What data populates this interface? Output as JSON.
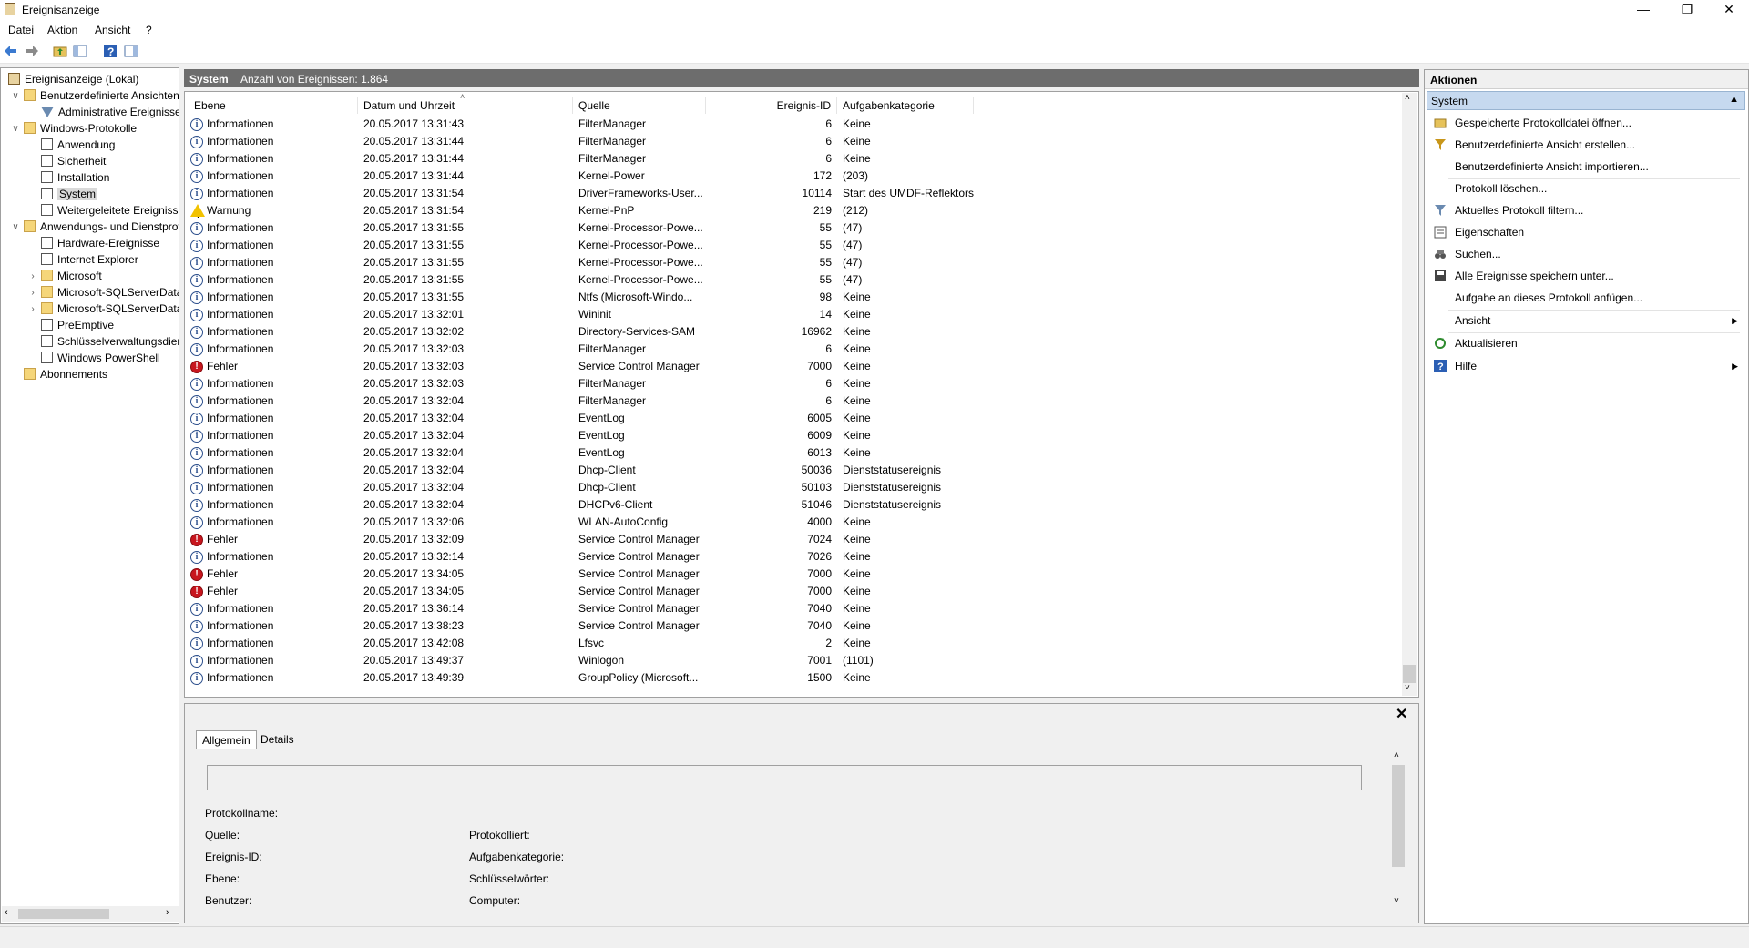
{
  "window": {
    "title": "Ereignisanzeige",
    "minimize": "—",
    "restore": "❐",
    "close": "✕"
  },
  "menu": [
    "Datei",
    "Aktion",
    "Ansicht",
    "?"
  ],
  "tree": {
    "root": "Ereignisanzeige (Lokal)",
    "custom_views": "Benutzerdefinierte Ansichten",
    "admin_events": "Administrative Ereignisse",
    "windows_logs": "Windows-Protokolle",
    "application": "Anwendung",
    "security": "Sicherheit",
    "setup": "Installation",
    "system": "System",
    "forwarded": "Weitergeleitete Ereignisse",
    "apps_services": "Anwendungs- und Dienstprotokolle",
    "hardware": "Hardware-Ereignisse",
    "ie": "Internet Explorer",
    "microsoft": "Microsoft",
    "sql1": "Microsoft-SQLServerDataTools",
    "sql2": "Microsoft-SQLServerDataToolsVS",
    "preemptive": "PreEmptive",
    "keymgmt": "Schlüsselverwaltungsdienst",
    "powershell": "Windows PowerShell",
    "subscriptions": "Abonnements"
  },
  "center": {
    "log_name": "System",
    "event_count": "Anzahl von Ereignissen: 1.864",
    "columns": {
      "level": "Ebene",
      "date": "Datum und Uhrzeit",
      "source": "Quelle",
      "id": "Ereignis-ID",
      "category": "Aufgabenkategorie"
    }
  },
  "events": [
    {
      "level": "info",
      "level_text": "Informationen",
      "date": "20.05.2017 13:31:43",
      "source": "FilterManager",
      "id": "6",
      "category": "Keine"
    },
    {
      "level": "info",
      "level_text": "Informationen",
      "date": "20.05.2017 13:31:44",
      "source": "FilterManager",
      "id": "6",
      "category": "Keine"
    },
    {
      "level": "info",
      "level_text": "Informationen",
      "date": "20.05.2017 13:31:44",
      "source": "FilterManager",
      "id": "6",
      "category": "Keine"
    },
    {
      "level": "info",
      "level_text": "Informationen",
      "date": "20.05.2017 13:31:44",
      "source": "Kernel-Power",
      "id": "172",
      "category": "(203)"
    },
    {
      "level": "info",
      "level_text": "Informationen",
      "date": "20.05.2017 13:31:54",
      "source": "DriverFrameworks-User...",
      "id": "10114",
      "category": "Start des UMDF-Reflektors"
    },
    {
      "level": "warn",
      "level_text": "Warnung",
      "date": "20.05.2017 13:31:54",
      "source": "Kernel-PnP",
      "id": "219",
      "category": "(212)"
    },
    {
      "level": "info",
      "level_text": "Informationen",
      "date": "20.05.2017 13:31:55",
      "source": "Kernel-Processor-Powe...",
      "id": "55",
      "category": "(47)"
    },
    {
      "level": "info",
      "level_text": "Informationen",
      "date": "20.05.2017 13:31:55",
      "source": "Kernel-Processor-Powe...",
      "id": "55",
      "category": "(47)"
    },
    {
      "level": "info",
      "level_text": "Informationen",
      "date": "20.05.2017 13:31:55",
      "source": "Kernel-Processor-Powe...",
      "id": "55",
      "category": "(47)"
    },
    {
      "level": "info",
      "level_text": "Informationen",
      "date": "20.05.2017 13:31:55",
      "source": "Kernel-Processor-Powe...",
      "id": "55",
      "category": "(47)"
    },
    {
      "level": "info",
      "level_text": "Informationen",
      "date": "20.05.2017 13:31:55",
      "source": "Ntfs (Microsoft-Windo...",
      "id": "98",
      "category": "Keine"
    },
    {
      "level": "info",
      "level_text": "Informationen",
      "date": "20.05.2017 13:32:01",
      "source": "Wininit",
      "id": "14",
      "category": "Keine"
    },
    {
      "level": "info",
      "level_text": "Informationen",
      "date": "20.05.2017 13:32:02",
      "source": "Directory-Services-SAM",
      "id": "16962",
      "category": "Keine"
    },
    {
      "level": "info",
      "level_text": "Informationen",
      "date": "20.05.2017 13:32:03",
      "source": "FilterManager",
      "id": "6",
      "category": "Keine"
    },
    {
      "level": "err",
      "level_text": "Fehler",
      "date": "20.05.2017 13:32:03",
      "source": "Service Control Manager",
      "id": "7000",
      "category": "Keine"
    },
    {
      "level": "info",
      "level_text": "Informationen",
      "date": "20.05.2017 13:32:03",
      "source": "FilterManager",
      "id": "6",
      "category": "Keine"
    },
    {
      "level": "info",
      "level_text": "Informationen",
      "date": "20.05.2017 13:32:04",
      "source": "FilterManager",
      "id": "6",
      "category": "Keine"
    },
    {
      "level": "info",
      "level_text": "Informationen",
      "date": "20.05.2017 13:32:04",
      "source": "EventLog",
      "id": "6005",
      "category": "Keine"
    },
    {
      "level": "info",
      "level_text": "Informationen",
      "date": "20.05.2017 13:32:04",
      "source": "EventLog",
      "id": "6009",
      "category": "Keine"
    },
    {
      "level": "info",
      "level_text": "Informationen",
      "date": "20.05.2017 13:32:04",
      "source": "EventLog",
      "id": "6013",
      "category": "Keine"
    },
    {
      "level": "info",
      "level_text": "Informationen",
      "date": "20.05.2017 13:32:04",
      "source": "Dhcp-Client",
      "id": "50036",
      "category": "Dienststatusereignis"
    },
    {
      "level": "info",
      "level_text": "Informationen",
      "date": "20.05.2017 13:32:04",
      "source": "Dhcp-Client",
      "id": "50103",
      "category": "Dienststatusereignis"
    },
    {
      "level": "info",
      "level_text": "Informationen",
      "date": "20.05.2017 13:32:04",
      "source": "DHCPv6-Client",
      "id": "51046",
      "category": "Dienststatusereignis"
    },
    {
      "level": "info",
      "level_text": "Informationen",
      "date": "20.05.2017 13:32:06",
      "source": "WLAN-AutoConfig",
      "id": "4000",
      "category": "Keine"
    },
    {
      "level": "err",
      "level_text": "Fehler",
      "date": "20.05.2017 13:32:09",
      "source": "Service Control Manager",
      "id": "7024",
      "category": "Keine"
    },
    {
      "level": "info",
      "level_text": "Informationen",
      "date": "20.05.2017 13:32:14",
      "source": "Service Control Manager",
      "id": "7026",
      "category": "Keine"
    },
    {
      "level": "err",
      "level_text": "Fehler",
      "date": "20.05.2017 13:34:05",
      "source": "Service Control Manager",
      "id": "7000",
      "category": "Keine"
    },
    {
      "level": "err",
      "level_text": "Fehler",
      "date": "20.05.2017 13:34:05",
      "source": "Service Control Manager",
      "id": "7000",
      "category": "Keine"
    },
    {
      "level": "info",
      "level_text": "Informationen",
      "date": "20.05.2017 13:36:14",
      "source": "Service Control Manager",
      "id": "7040",
      "category": "Keine"
    },
    {
      "level": "info",
      "level_text": "Informationen",
      "date": "20.05.2017 13:38:23",
      "source": "Service Control Manager",
      "id": "7040",
      "category": "Keine"
    },
    {
      "level": "info",
      "level_text": "Informationen",
      "date": "20.05.2017 13:42:08",
      "source": "Lfsvc",
      "id": "2",
      "category": "Keine"
    },
    {
      "level": "info",
      "level_text": "Informationen",
      "date": "20.05.2017 13:49:37",
      "source": "Winlogon",
      "id": "7001",
      "category": "(1101)"
    },
    {
      "level": "info",
      "level_text": "Informationen",
      "date": "20.05.2017 13:49:39",
      "source": "GroupPolicy (Microsoft...",
      "id": "1500",
      "category": "Keine"
    }
  ],
  "details": {
    "close": "✕",
    "tab_general": "Allgemein",
    "tab_details": "Details",
    "log_name_label": "Protokollname:",
    "source_label": "Quelle:",
    "event_id_label": "Ereignis-ID:",
    "level_label": "Ebene:",
    "user_label": "Benutzer:",
    "logged_label": "Protokolliert:",
    "category_label": "Aufgabenkategorie:",
    "keywords_label": "Schlüsselwörter:",
    "computer_label": "Computer:"
  },
  "actions": {
    "header": "Aktionen",
    "section": "System",
    "items": [
      "Gespeicherte Protokolldatei öffnen...",
      "Benutzerdefinierte Ansicht erstellen...",
      "Benutzerdefinierte Ansicht importieren...",
      "Protokoll löschen...",
      "Aktuelles Protokoll filtern...",
      "Eigenschaften",
      "Suchen...",
      "Alle Ereignisse speichern unter...",
      "Aufgabe an dieses Protokoll anfügen...",
      "Ansicht",
      "Aktualisieren",
      "Hilfe"
    ]
  }
}
